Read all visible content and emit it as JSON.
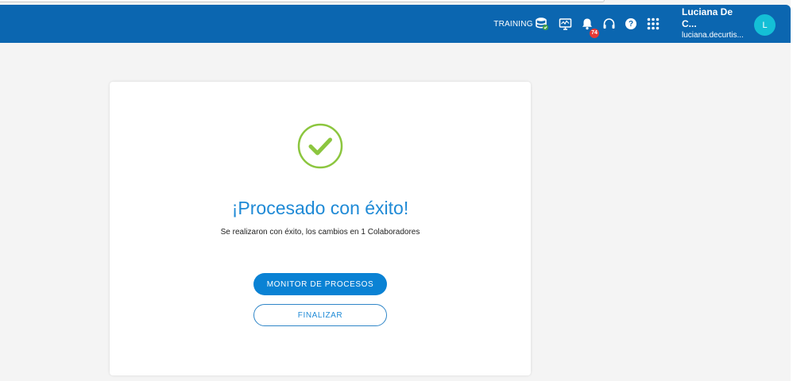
{
  "header": {
    "environment_label": "TRAINING",
    "icons": [
      "database-status-icon",
      "monitor-icon",
      "bell-icon",
      "headset-icon",
      "help-icon",
      "apps-grid-icon"
    ],
    "notifications_count": "74",
    "help_glyph": "?",
    "user": {
      "name": "Luciana De C...",
      "email": "luciana.decurtis...",
      "avatar_initial": "L"
    },
    "colors": {
      "bar": "#0b66b0",
      "avatar": "#14bfd6",
      "badge": "#e53935"
    }
  },
  "result": {
    "title": "¡Procesado con éxito!",
    "message": "Se realizaron con éxito, los cambios en 1 Colaboradores",
    "icon": "success-check-icon",
    "primary_button": "MONITOR DE PROCESOS",
    "secondary_button": "FINALIZAR",
    "colors": {
      "success": "#8cc63f",
      "accent": "#1f8ad6"
    }
  }
}
